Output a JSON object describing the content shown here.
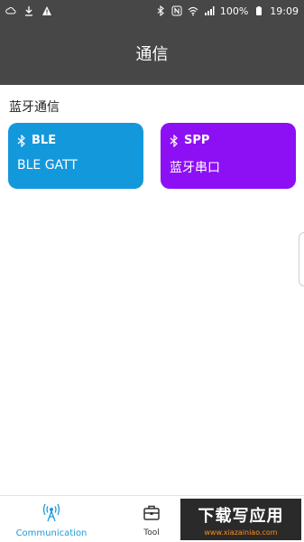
{
  "status_bar": {
    "battery": "100%",
    "time": "19:09",
    "icons_left": [
      "cloud-icon",
      "download-icon",
      "warning-icon"
    ],
    "icons_right": [
      "bluetooth-icon",
      "nfc-icon",
      "wifi-icon",
      "signal-icon",
      "battery-icon"
    ]
  },
  "header": {
    "title": "通信"
  },
  "section": {
    "title": "蓝牙通信"
  },
  "cards": [
    {
      "icon": "bluetooth-icon",
      "title": "BLE",
      "subtitle": "BLE GATT",
      "color": "#1498dc"
    },
    {
      "icon": "bluetooth-icon",
      "title": "SPP",
      "subtitle": "蓝牙串口",
      "color": "#8d10f5"
    }
  ],
  "bottom_nav": {
    "items": [
      {
        "label": "Communication",
        "icon": "antenna-icon",
        "active": true,
        "color": "#1d9bd9"
      },
      {
        "label": "Tool",
        "icon": "toolbox-icon",
        "active": false
      }
    ]
  },
  "watermark": {
    "text": "下载写应用",
    "url": "www.xiazainiao.com"
  }
}
